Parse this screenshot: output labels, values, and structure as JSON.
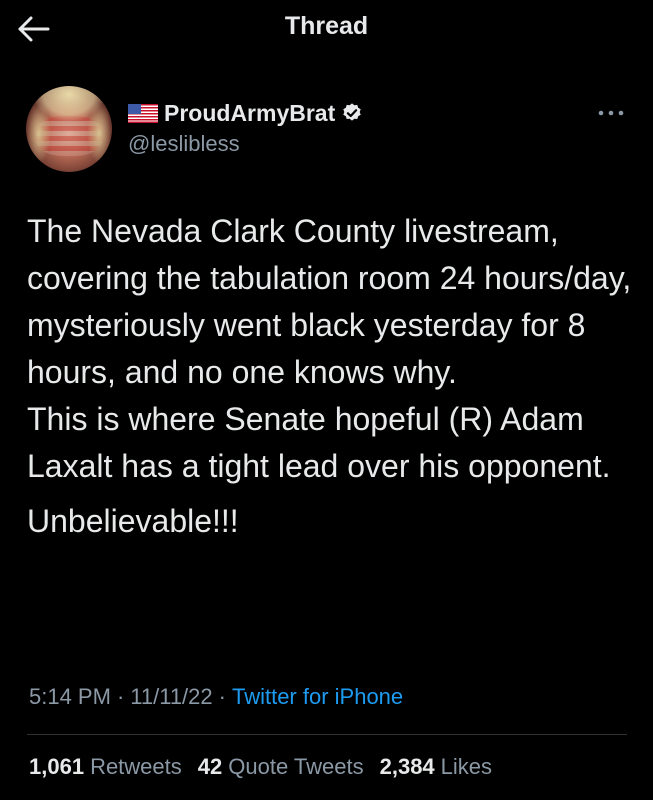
{
  "header": {
    "title": "Thread",
    "back_icon": "arrow-left-icon"
  },
  "author": {
    "flag_icon": "us-flag-icon",
    "display_name": "ProudArmyBrat",
    "handle": "@leslibless",
    "verified_icon": "verified-badge-icon",
    "avatar_icon": "profile-avatar"
  },
  "more_icon": "more-dots-icon",
  "tweet": {
    "paragraphs": [
      "The Nevada Clark County livestream, covering the tabulation room 24 hours/day, mysteriously went black yesterday for 8 hours, and no one knows why.",
      "This is where Senate hopeful (R) Adam Laxalt has a tight lead over his opponent.",
      "Unbelievable!!!"
    ]
  },
  "meta": {
    "time": "5:14 PM",
    "separator": "·",
    "date": "11/11/22",
    "source": "Twitter for iPhone"
  },
  "stats": {
    "retweets_count": "1,061",
    "retweets_label": "Retweets",
    "quotes_count": "42",
    "quotes_label": "Quote Tweets",
    "likes_count": "2,384",
    "likes_label": "Likes"
  },
  "colors": {
    "background": "#000000",
    "text": "#e7e9ea",
    "secondary": "#8b98a5",
    "link": "#1d9bf0",
    "divider": "#2f3336"
  }
}
